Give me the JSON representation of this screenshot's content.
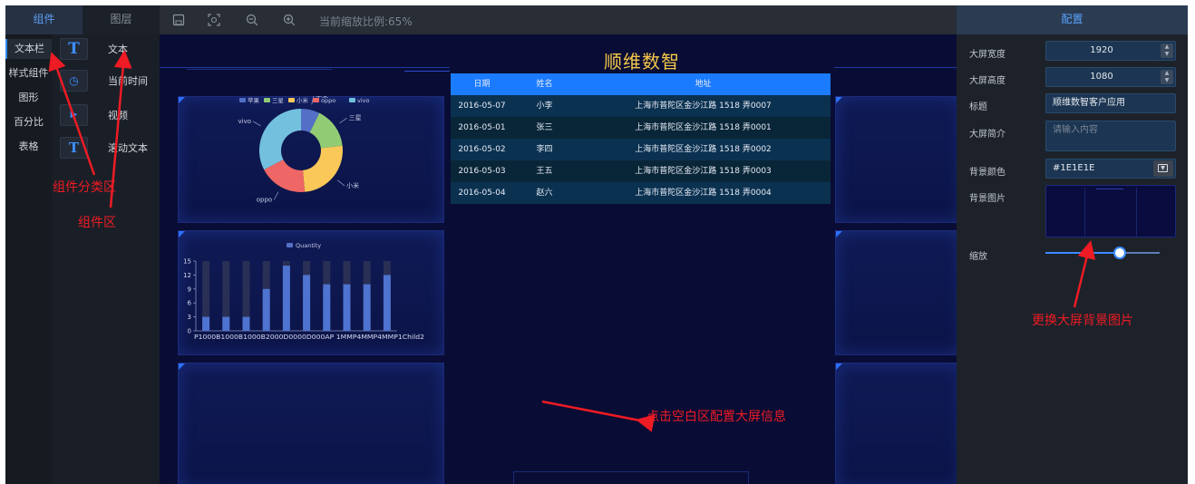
{
  "tabs": {
    "components": "组件",
    "layers": "图层"
  },
  "categories": [
    {
      "label": "文本栏",
      "active": true
    },
    {
      "label": "样式组件",
      "active": false
    },
    {
      "label": "图形",
      "active": false
    },
    {
      "label": "百分比",
      "active": false
    },
    {
      "label": "表格",
      "active": false
    }
  ],
  "components": [
    {
      "label": "文本",
      "icon": "text-t-icon",
      "glyph": "T"
    },
    {
      "label": "当前时间",
      "icon": "clock-calendar-icon",
      "glyph": "◷"
    },
    {
      "label": "视频",
      "icon": "video-play-icon",
      "glyph": "▶"
    },
    {
      "label": "滚动文本",
      "icon": "scroll-text-icon",
      "glyph": "T"
    }
  ],
  "toolbar": {
    "zoom_text": "当前缩放比例:65%"
  },
  "screen": {
    "title": "顺维数智",
    "table": {
      "headers": [
        "日期",
        "姓名",
        "地址"
      ],
      "rows": [
        [
          "2016-05-07",
          "小李",
          "上海市普陀区金沙江路 1518 弄0007"
        ],
        [
          "2016-05-01",
          "张三",
          "上海市普陀区金沙江路 1518 弄0001"
        ],
        [
          "2016-05-02",
          "李四",
          "上海市普陀区金沙江路 1518 弄0002"
        ],
        [
          "2016-05-03",
          "王五",
          "上海市普陀区金沙江路 1518 弄0003"
        ],
        [
          "2016-05-04",
          "赵六",
          "上海市普陀区金沙江路 1518 弄0004"
        ]
      ]
    }
  },
  "config": {
    "title": "配置",
    "fields": {
      "width_label": "大屏宽度",
      "width_value": "1920",
      "height_label": "大屏高度",
      "height_value": "1080",
      "title_label": "标题",
      "title_value": "顺维数智客户应用",
      "intro_label": "大屏简介",
      "intro_placeholder": "请输入内容",
      "bgcolor_label": "背景颜色",
      "bgcolor_value": "#1E1E1E",
      "bgimage_label": "背景图片",
      "scale_label": "缩放"
    },
    "scale_fraction": 0.65
  },
  "annotations": {
    "category_area": "组件分类区",
    "component_area": "组件区",
    "blank_area": "点击空白区配置大屏信息",
    "bg_image": "更换大屏背景图片"
  },
  "colors": {
    "accent": "#2d8cf0",
    "annotation": "#ee1b24",
    "screen_title": "#f5c84a",
    "canvas": "#090c34"
  },
  "chart_data": [
    {
      "type": "pie",
      "legend": [
        "苹果",
        "三星",
        "小米",
        "oppo",
        "vivo"
      ],
      "colors": [
        "#5470c6",
        "#91cc75",
        "#fac858",
        "#ee6666",
        "#73c0de"
      ],
      "values": [
        10,
        22,
        35,
        26,
        45
      ]
    },
    {
      "type": "bar",
      "series": [
        {
          "name": "Quantity",
          "values": [
            3,
            3,
            3,
            9,
            14,
            12,
            10,
            10,
            10,
            12
          ]
        }
      ],
      "ylim": [
        0,
        15
      ],
      "yticks": [
        0,
        3,
        6,
        9,
        12,
        15
      ],
      "category_label_text": "P1000B1000B1000B2000D0000D000AP 1MMP4MMP4MMP1Child2",
      "background_value": 15
    }
  ]
}
